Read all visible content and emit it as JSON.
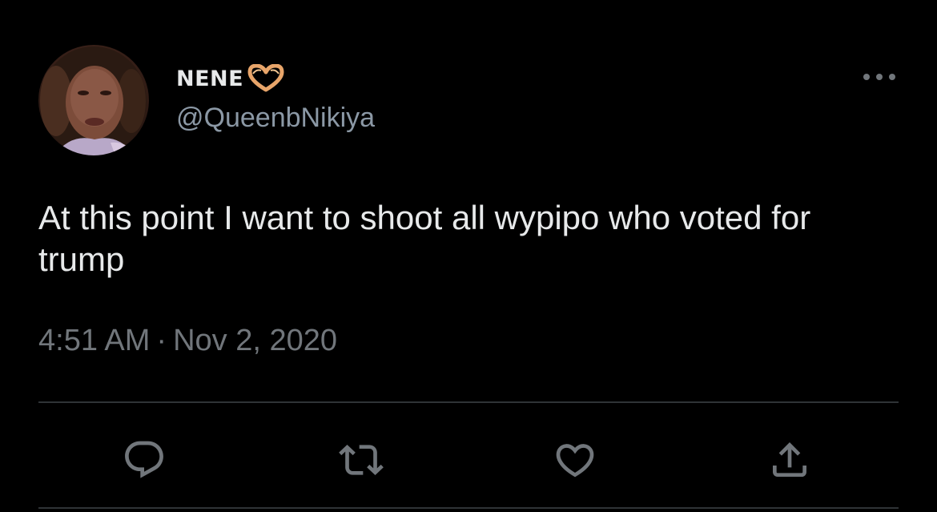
{
  "author": {
    "display_name": "NENE",
    "handle": "@QueenbNikiya",
    "avatar_alt": "profile photo",
    "name_emoji": "heart-hands-emoji"
  },
  "tweet": {
    "text": "At this point I want to shoot all wypipo who voted for trump",
    "time": "4:51 AM",
    "separator": "·",
    "date": "Nov 2, 2020"
  },
  "actions": [
    {
      "name": "reply",
      "icon": "reply-icon"
    },
    {
      "name": "retweet",
      "icon": "retweet-icon"
    },
    {
      "name": "like",
      "icon": "heart-icon"
    },
    {
      "name": "share",
      "icon": "share-icon"
    }
  ],
  "colors": {
    "background": "#000000",
    "primary_text": "#e7e9ea",
    "secondary_text": "#71767b",
    "handle_text": "#8b98a5",
    "icon": "#71767b",
    "divider": "#2f3336"
  }
}
